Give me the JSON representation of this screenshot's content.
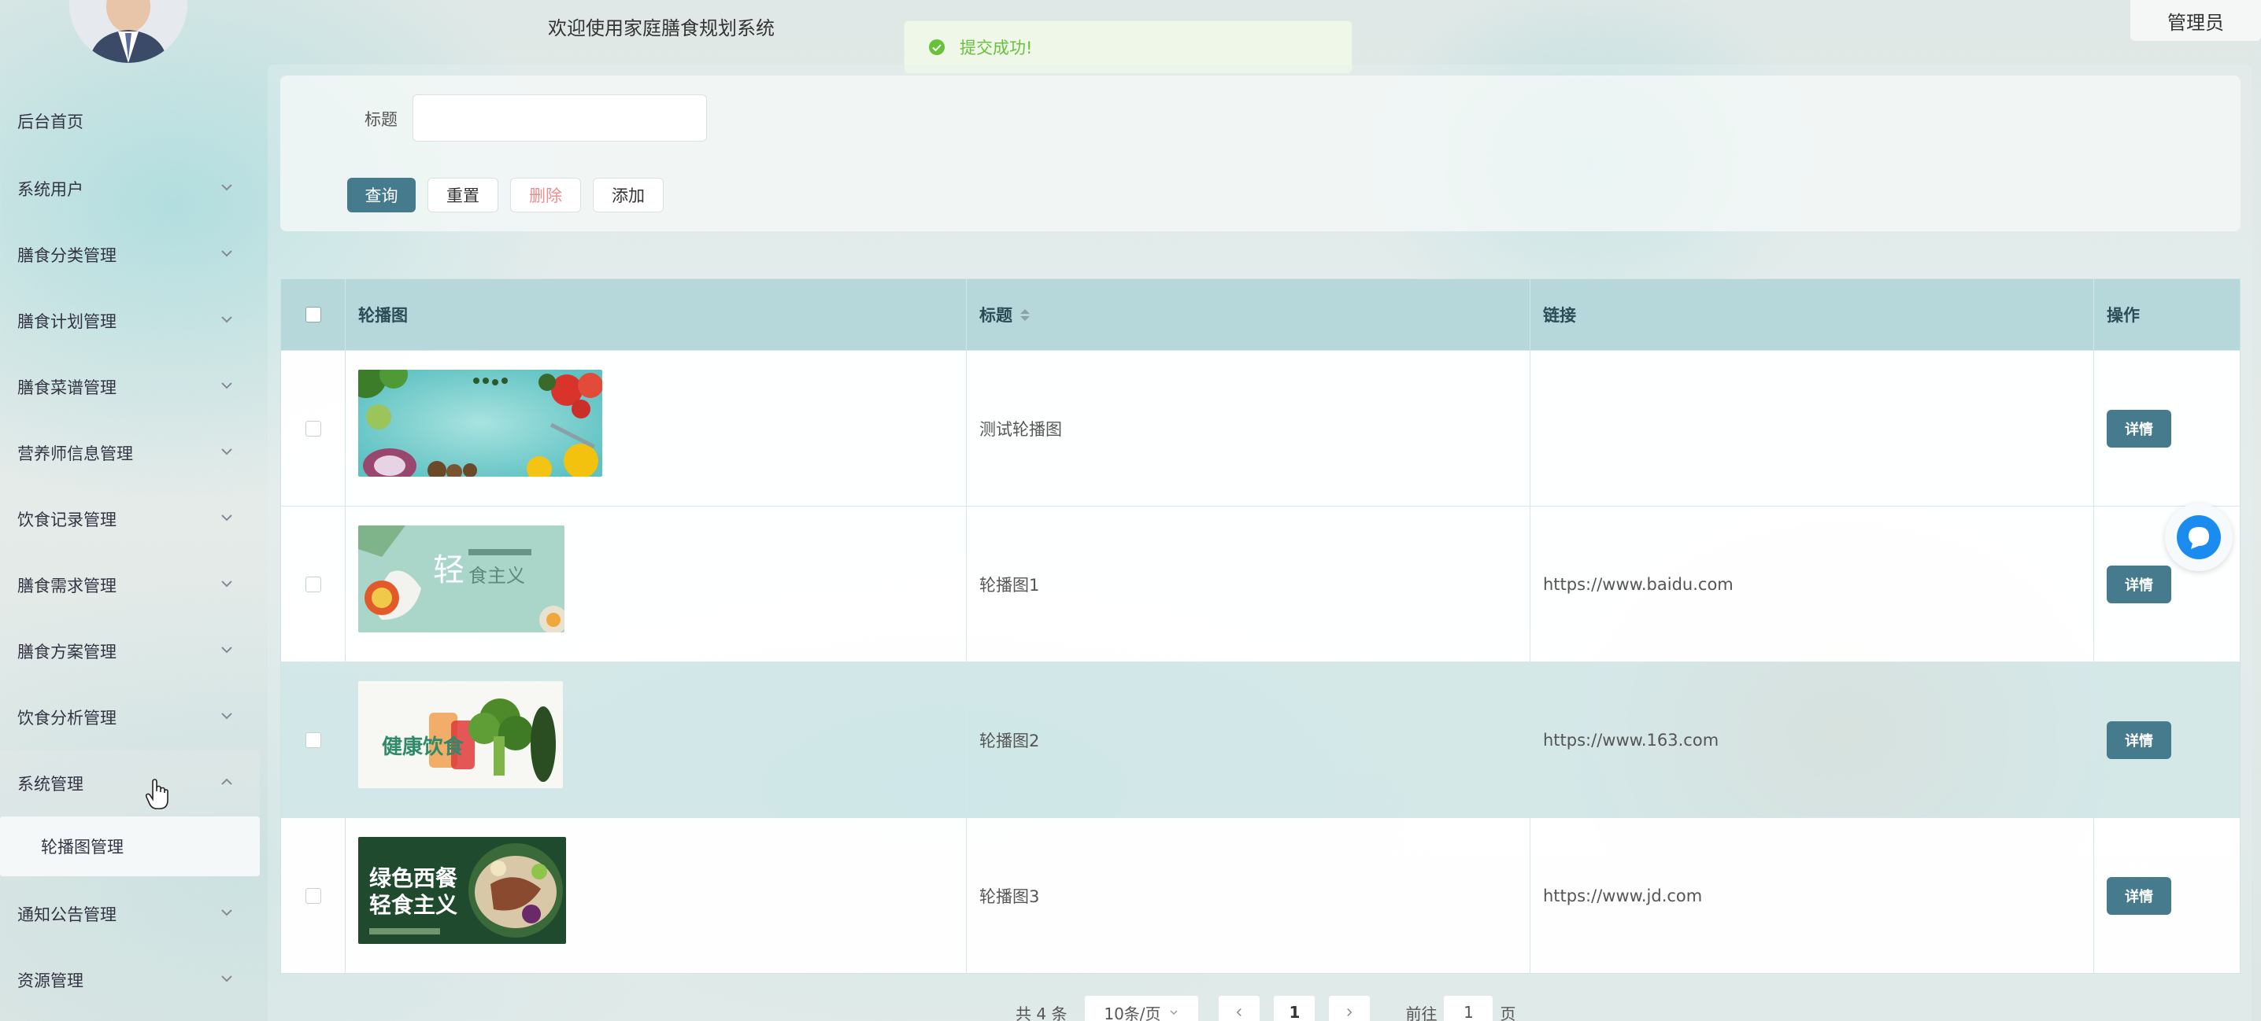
{
  "header": {
    "welcome": "欢迎使用家庭膳食规划系统",
    "toast": "提交成功!",
    "user_menu": "管理员"
  },
  "sidebar": {
    "items": [
      {
        "label": "后台首页"
      },
      {
        "label": "系统用户"
      },
      {
        "label": "膳食分类管理"
      },
      {
        "label": "膳食计划管理"
      },
      {
        "label": "膳食菜谱管理"
      },
      {
        "label": "营养师信息管理"
      },
      {
        "label": "饮食记录管理"
      },
      {
        "label": "膳食需求管理"
      },
      {
        "label": "膳食方案管理"
      },
      {
        "label": "饮食分析管理"
      },
      {
        "label": "系统管理"
      },
      {
        "label": "通知公告管理"
      },
      {
        "label": "资源管理"
      }
    ],
    "submenu": [
      {
        "label": "轮播图管理"
      }
    ]
  },
  "search": {
    "title_label": "标题",
    "title_value": "",
    "buttons": {
      "query": "查询",
      "reset": "重置",
      "delete": "删除",
      "add": "添加"
    }
  },
  "table": {
    "columns": [
      "轮播图",
      "标题",
      "链接",
      "操作"
    ],
    "rows": [
      {
        "title": "测试轮播图",
        "link": "",
        "action": "详情",
        "image": "vegetables-banner"
      },
      {
        "title": "轮播图1",
        "link": "https://www.baidu.com",
        "action": "详情",
        "image": "light-food-banner",
        "image_text": "轻食主义"
      },
      {
        "title": "轮播图2",
        "link": "https://www.163.com",
        "action": "详情",
        "image": "healthy-diet-banner",
        "image_text": "健康饮食"
      },
      {
        "title": "轮播图3",
        "link": "https://www.jd.com",
        "action": "详情",
        "image": "green-western-banner",
        "image_text": "绿色西餐 轻食主义"
      }
    ]
  },
  "pagination": {
    "total": "共 4 条",
    "page_size": "10条/页",
    "current_page": "1",
    "goto_prefix": "前往",
    "goto_value": "1",
    "goto_suffix": "页"
  },
  "colors": {
    "primary": "#467b8d",
    "header_row": "#b7d8db",
    "success": "#67c23a",
    "danger_text": "#e88e8e"
  }
}
